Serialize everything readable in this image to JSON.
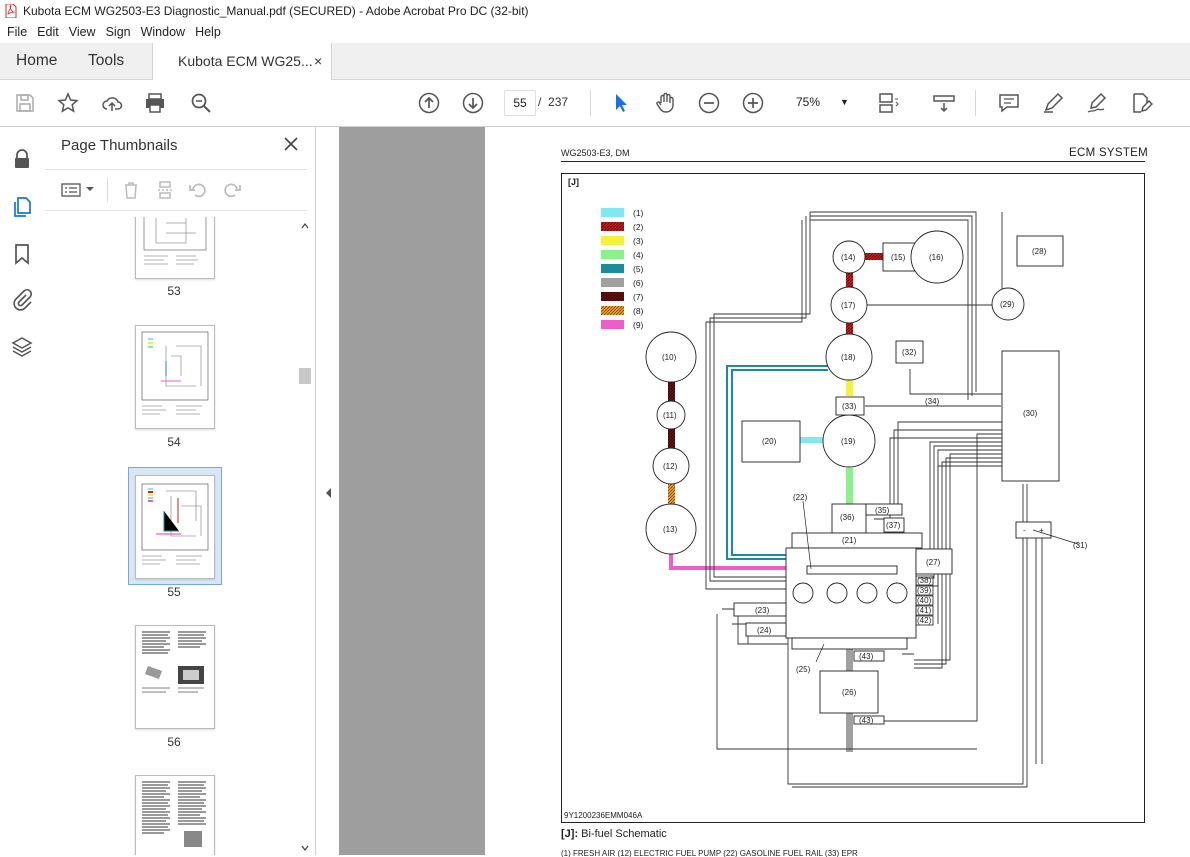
{
  "window": {
    "title": "Kubota ECM WG2503-E3 Diagnostic_Manual.pdf (SECURED) - Adobe Acrobat Pro DC (32-bit)"
  },
  "menu": [
    "File",
    "Edit",
    "View",
    "Sign",
    "Window",
    "Help"
  ],
  "tabs": {
    "home": "Home",
    "tools": "Tools",
    "doc": "Kubota ECM WG25...",
    "close": "×"
  },
  "toolbar": {
    "page_current": "55",
    "page_sep": "/",
    "page_total": "237",
    "zoom": "75%"
  },
  "panel": {
    "title": "Page Thumbnails",
    "thumbs": [
      "53",
      "54",
      "55",
      "56"
    ]
  },
  "page": {
    "header_left": "WG2503-E3, DM",
    "header_right": "ECM SYSTEM",
    "fig_tag": "[J]",
    "fig_code": "9Y1200236EMM046A",
    "caption_tag": "[J]:",
    "caption_text": "Bi-fuel Schematic",
    "bottom_partial": "(1)   FRESH AIR                    (12) ELECTRIC FUEL PUMP           (22) GASOLINE FUEL RAIL            (33) EPR"
  },
  "legend": [
    "(1)",
    "(2)",
    "(3)",
    "(4)",
    "(5)",
    "(6)",
    "(7)",
    "(8)",
    "(9)"
  ],
  "colors": {
    "air": "#7fe8f0",
    "red": "#cc1f1f",
    "yellow": "#f5f03a",
    "green": "#8cf08c",
    "teal": "#1a8c9c",
    "gray": "#a0a0a0",
    "darkred": "#6b1414",
    "orange": "#f0a030",
    "pink": "#f05cc8",
    "acrobat_blue": "#1473e6"
  },
  "nodes": [
    "(10)",
    "(11)",
    "(12)",
    "(13)",
    "(14)",
    "(15)",
    "(16)",
    "(17)",
    "(18)",
    "(19)",
    "(20)",
    "(21)",
    "(22)",
    "(23)",
    "(24)",
    "(25)",
    "(26)",
    "(27)",
    "(28)",
    "(29)",
    "(30)",
    "(31)",
    "(32)",
    "(33)",
    "(34)",
    "(35)",
    "(36)",
    "(37)",
    "(38)",
    "(39)",
    "(40)",
    "(41)",
    "(42)",
    "(43)",
    "(43)"
  ],
  "pm": [
    "-",
    "+"
  ]
}
